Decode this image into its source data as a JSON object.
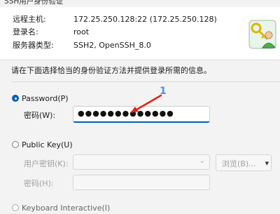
{
  "window": {
    "title": "SSH用户身份验证"
  },
  "info": {
    "remote_host_label": "远程主机:",
    "remote_host_value": "172.25.250.128:22 (172.25.250.128)",
    "login_name_label": "登录名:",
    "login_name_value": "root",
    "server_type_label": "服务器类型:",
    "server_type_value": "SSH2, OpenSSH_8.0",
    "icon": "keys-and-user-icon"
  },
  "instruction": "请在下面选择恰当的身份验证方法并提供登录所需的信息。",
  "password_method": {
    "label": "Password(P)",
    "selected": true,
    "field_label": "密码(W):",
    "masked_value": "●●●●●●●●●●●●●"
  },
  "annotation": {
    "number": "1",
    "color": "#e0231b"
  },
  "public_key_method": {
    "label": "Public Key(U)",
    "selected": false,
    "user_key_label": "用户密钥(K):",
    "browse_label": "浏览(B)...",
    "passphrase_label": "密码(H):"
  },
  "keyboard_interactive_method": {
    "label": "Keyboard Interactive(I)",
    "selected": false
  },
  "colors": {
    "accent": "#005fb8",
    "disabled_text": "#a0a0a0"
  }
}
